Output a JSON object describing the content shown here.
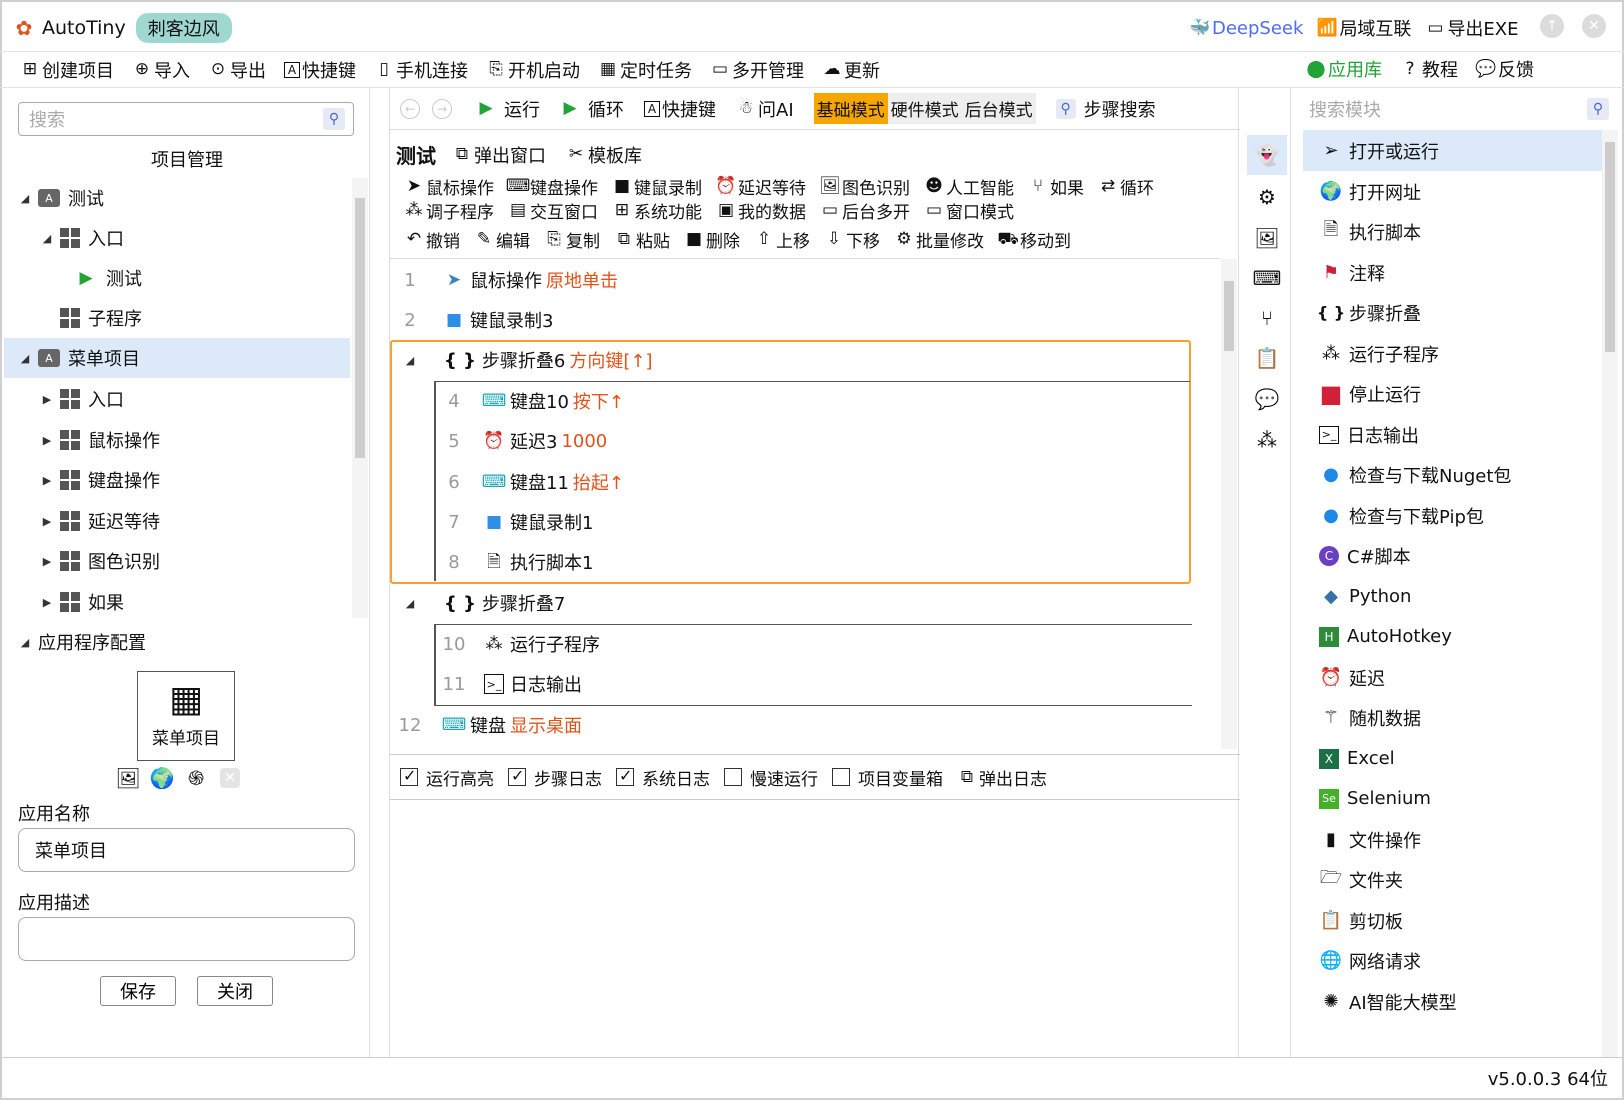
{
  "title": {
    "app_name": "AutoTiny",
    "badge": "刺客边风",
    "deepseek": "DeepSeek",
    "lan": "局域互联",
    "export_exe": "导出EXE"
  },
  "menu": [
    "创建项目",
    "导入",
    "导出",
    "快捷键",
    "手机连接",
    "开机启动",
    "定时任务",
    "多开管理",
    "更新"
  ],
  "menu_right": [
    "应用库",
    "教程",
    "反馈"
  ],
  "left": {
    "search_placeholder": "搜索",
    "header": "项目管理",
    "tree": [
      "测试",
      "入口",
      "测试",
      "子程序",
      "菜单项目",
      "入口",
      "鼠标操作",
      "键盘操作",
      "延迟等待",
      "图色识别",
      "如果"
    ],
    "config_title": "应用程序配置",
    "app_tile_label": "菜单项目",
    "name_label": "应用名称",
    "name_value": "菜单项目",
    "desc_label": "应用描述",
    "desc_value": "",
    "save": "保存",
    "close": "关闭"
  },
  "toolbar": {
    "run": "运行",
    "loop": "循环",
    "shortcut": "快捷键",
    "ask_ai": "问AI",
    "mode_basic": "基础模式",
    "mode_hw": "硬件模式",
    "mode_bg": "后台模式",
    "step_search": "步骤搜索"
  },
  "editor": {
    "title": "测试",
    "popup": "弹出窗口",
    "templates": "模板库",
    "cmd_row1": [
      "鼠标操作",
      "键盘操作",
      "键鼠录制",
      "延迟等待",
      "图色识别",
      "人工智能",
      "如果",
      "循环"
    ],
    "cmd_row2": [
      "调子程序",
      "交互窗口",
      "系统功能",
      "我的数据",
      "后台多开",
      "窗口模式"
    ],
    "edit_row": [
      "撤销",
      "编辑",
      "复制",
      "粘贴",
      "删除",
      "上移",
      "下移",
      "批量修改",
      "移动到"
    ]
  },
  "steps": [
    {
      "n": "1",
      "name": "鼠标操作",
      "arg": "原地单击"
    },
    {
      "n": "2",
      "name": "键鼠录制3",
      "arg": ""
    },
    {
      "n": "",
      "name": "步骤折叠6",
      "arg": "方向键[↑]"
    },
    {
      "n": "4",
      "name": "键盘10",
      "arg": "按下↑"
    },
    {
      "n": "5",
      "name": "延迟3",
      "arg": "1000"
    },
    {
      "n": "6",
      "name": "键盘11",
      "arg": "抬起↑"
    },
    {
      "n": "7",
      "name": "键鼠录制1",
      "arg": ""
    },
    {
      "n": "8",
      "name": "执行脚本1",
      "arg": ""
    },
    {
      "n": "",
      "name": "步骤折叠7",
      "arg": ""
    },
    {
      "n": "10",
      "name": "运行子程序",
      "arg": ""
    },
    {
      "n": "11",
      "name": "日志输出",
      "arg": ""
    },
    {
      "n": "12",
      "name": "键盘",
      "arg": "显示桌面"
    }
  ],
  "log_options": [
    {
      "label": "运行高亮",
      "checked": true
    },
    {
      "label": "步骤日志",
      "checked": true
    },
    {
      "label": "系统日志",
      "checked": true
    },
    {
      "label": "慢速运行",
      "checked": false
    },
    {
      "label": "项目变量箱",
      "checked": false
    }
  ],
  "popup_log": "弹出日志",
  "right": {
    "search_placeholder": "搜索模块",
    "modules": [
      "打开或运行",
      "打开网址",
      "执行脚本",
      "注释",
      "步骤折叠",
      "运行子程序",
      "停止运行",
      "日志输出",
      "检查与下载Nuget包",
      "检查与下载Pip包",
      "C#脚本",
      "Python",
      "AutoHotkey",
      "延迟",
      "随机数据",
      "Excel",
      "Selenium",
      "文件操作",
      "文件夹",
      "剪切板",
      "网络请求",
      "AI智能大模型"
    ]
  },
  "status": {
    "version": "v5.0.0.3 64位"
  },
  "colors": {
    "accent": "#e8f0fb",
    "highlight_border": "#f5a030",
    "mode_active": "#f7a600",
    "green_run": "#21a336",
    "value_orange": "#e0531b",
    "deepseek_blue": "#4d6bfe"
  }
}
